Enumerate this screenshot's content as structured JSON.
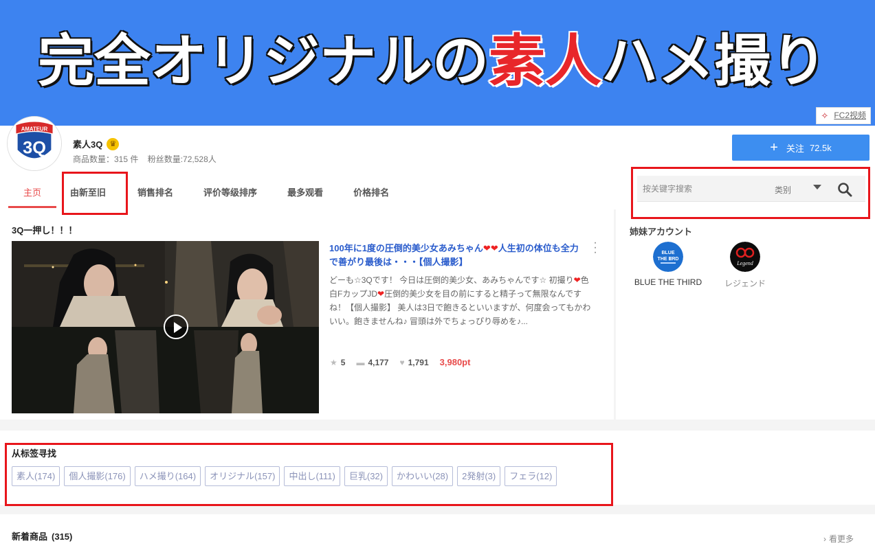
{
  "banner": {
    "part1": "完全オリジナルの",
    "accent": "素人",
    "part2": "ハメ撮り"
  },
  "fc2_link": "FC2视频",
  "shop": {
    "name": "素人3Q",
    "product_count": "商品数量：315 件",
    "fans_count": "粉丝数量:72,528人",
    "avatar_text": "3Q",
    "avatar_sub": "AMATEUR"
  },
  "follow": {
    "label": "关注",
    "count": "72.5k"
  },
  "tabs": [
    {
      "label": "主页"
    },
    {
      "label": "由新至旧"
    },
    {
      "label": "销售排名"
    },
    {
      "label": "评价等级排序"
    },
    {
      "label": "最多观看"
    },
    {
      "label": "价格排名"
    }
  ],
  "search": {
    "placeholder": "按关键字搜索",
    "category": "类别"
  },
  "featured": {
    "section_title": "3Q一押し！！！",
    "title_a": "100年に1度の圧倒的美少女あみちゃん",
    "title_b": "人生初の体位も全力で善がり最後は・・・【個人撮影】",
    "desc_a": "どーも☆3Qです！ 今日は圧倒的美少女、あみちゃんです☆ 初撮り",
    "desc_b": "色白FカップJD",
    "desc_c": "圧倒的美少女を目の前にすると精子って無限なんですね！【個人撮影】 美人は3日で飽きるといいますが、何度会ってもかわいい。飽きませんね♪ 冒頭は外でちょっぴり辱めを♪...",
    "rating": "5",
    "comments": "4,177",
    "likes": "1,791",
    "price": "3,980pt"
  },
  "sister": {
    "title": "姉妹アカウント",
    "accounts": [
      {
        "name": "BLUE THE THIRD"
      },
      {
        "name": "レジェンド"
      }
    ]
  },
  "tag_section": {
    "title": "从标签寻找",
    "tags": [
      "素人(174)",
      "個人撮影(176)",
      "ハメ撮り(164)",
      "オリジナル(157)",
      "中出し(111)",
      "巨乳(32)",
      "かわいい(28)",
      "2発射(3)",
      "フェラ(12)"
    ]
  },
  "new_items": {
    "title": "新着商品",
    "count": "(315)",
    "see_more": "看更多"
  },
  "colors": {
    "banner": "#3d83f0",
    "accent_red": "#e84a4a",
    "follow_btn": "#3d8ef0",
    "link_blue": "#2a5ccc"
  }
}
